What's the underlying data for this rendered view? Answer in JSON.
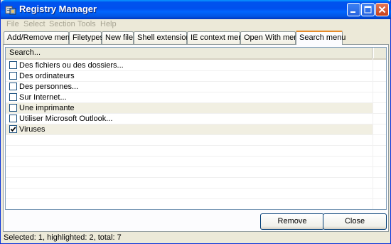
{
  "window": {
    "title": "Registry Manager"
  },
  "menubar": [
    "File",
    "Select",
    "Section",
    "Tools",
    "Help"
  ],
  "tabs": [
    {
      "label": "Add/Remove menu",
      "active": false
    },
    {
      "label": "Filetypes",
      "active": false
    },
    {
      "label": "New file",
      "active": false
    },
    {
      "label": "Shell extensions",
      "active": false
    },
    {
      "label": "IE context menu",
      "active": false
    },
    {
      "label": "Open With menu",
      "active": false
    },
    {
      "label": "Search menu",
      "active": true
    }
  ],
  "list": {
    "column_header": "Search...",
    "items": [
      {
        "label": "Des fichiers ou des dossiers...",
        "checked": false,
        "highlighted": false
      },
      {
        "label": "Des ordinateurs",
        "checked": false,
        "highlighted": false
      },
      {
        "label": "Des personnes...",
        "checked": false,
        "highlighted": false
      },
      {
        "label": "Sur Internet...",
        "checked": false,
        "highlighted": false
      },
      {
        "label": "Une imprimante",
        "checked": false,
        "highlighted": true
      },
      {
        "label": "Utiliser Microsoft Outlook...",
        "checked": false,
        "highlighted": false
      },
      {
        "label": "Viruses",
        "checked": true,
        "highlighted": true
      }
    ]
  },
  "buttons": {
    "remove": "Remove",
    "close": "Close"
  },
  "status": "Selected: 1, highlighted: 2, total: 7",
  "colors": {
    "titlebar": "#0053ee",
    "highlight_row": "#f1efe2",
    "active_tab_accent": "#e68b2c"
  }
}
